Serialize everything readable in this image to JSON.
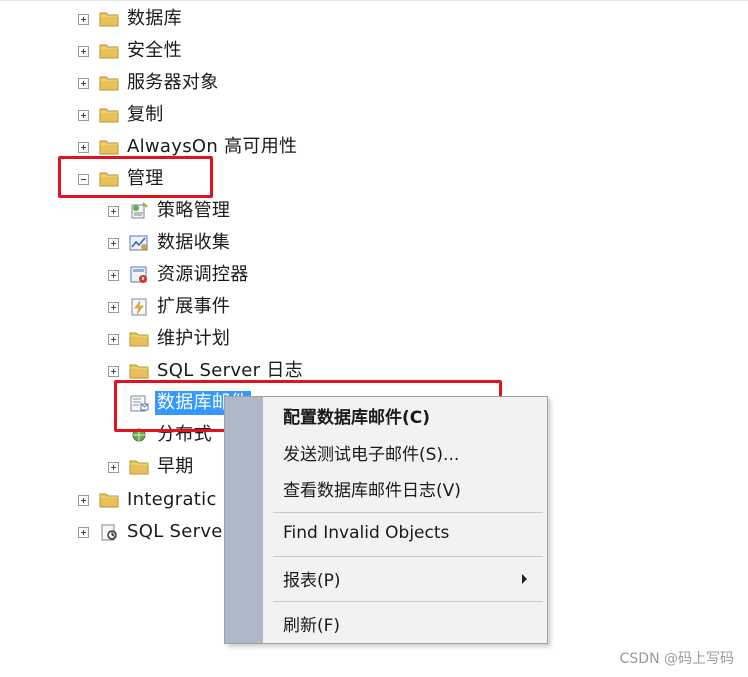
{
  "tree": {
    "databases": "数据库",
    "security": "安全性",
    "server_objects": "服务器对象",
    "replication": "复制",
    "alwayson": "AlwaysOn 高可用性",
    "management": "管理",
    "policy_management": "策略管理",
    "data_collection": "数据收集",
    "resource_governor": "资源调控器",
    "extended_events": "扩展事件",
    "maintenance_plans": "维护计划",
    "sql_server_logs": "SQL Server 日志",
    "database_mail": "数据库邮件",
    "distributed": "分布式",
    "legacy": "早期",
    "integration": "Integratic",
    "sql_server_agent": "SQL Serve"
  },
  "context_menu": {
    "configure_mail": "配置数据库邮件(C)",
    "send_test": "发送测试电子邮件(S)...",
    "view_log": "查看数据库邮件日志(V)",
    "find_invalid": "Find Invalid Objects",
    "reports": "报表(P)",
    "refresh": "刷新(F)"
  },
  "watermark": "CSDN @码上写码",
  "colors": {
    "highlight": "#e0141e",
    "selection": "#3399ff",
    "menu_gutter": "#aeb8c8",
    "folder": "#e8c15a"
  },
  "icons": {
    "folder": "folder-icon",
    "policy": "policy-icon",
    "data_collection": "chart-icon",
    "resource_governor": "governor-icon",
    "extended_events": "events-icon",
    "database_mail": "mail-icon",
    "agent": "agent-icon",
    "submenu": "chevron-right-icon"
  }
}
